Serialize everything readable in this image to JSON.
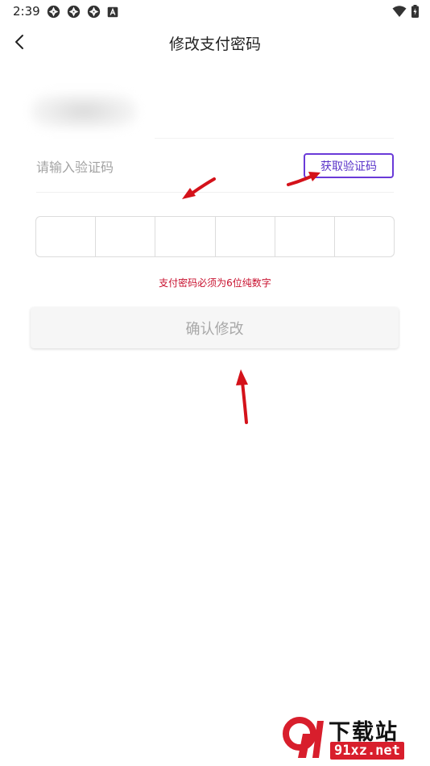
{
  "status_bar": {
    "time": "2:39",
    "left_icons": [
      "aperture-icon",
      "aperture-icon",
      "aperture-icon",
      "a-box-icon"
    ],
    "right_icons": [
      "wifi-icon",
      "battery-charging-icon"
    ]
  },
  "header": {
    "title": "修改支付密码",
    "back_icon": "chevron-left-icon"
  },
  "verification": {
    "placeholder": "请输入验证码",
    "get_code_label": "获取验证码",
    "accent_color": "#6a3ad8"
  },
  "pin": {
    "cells": [
      "",
      "",
      "",
      "",
      "",
      ""
    ]
  },
  "hint": {
    "text": "支付密码必须为6位纯数字",
    "color": "#c8102e"
  },
  "confirm": {
    "label": "确认修改"
  },
  "watermark": {
    "title": "下载站",
    "subtitle": "91xz.net",
    "logo_icon": "91-logo-icon"
  }
}
